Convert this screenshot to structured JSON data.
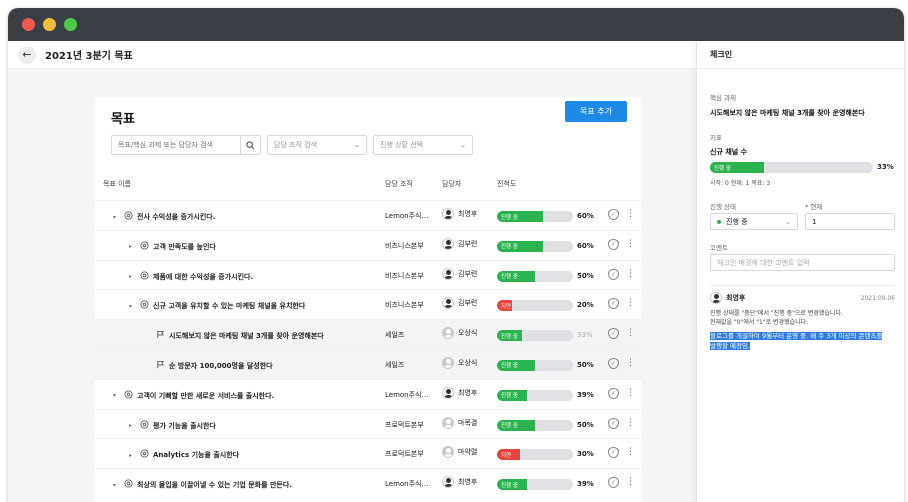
{
  "window": {
    "colors": {
      "close": "#ee5b51",
      "minimize": "#f3bd39",
      "maximize": "#4dc946",
      "titlebar": "#3b3f45"
    }
  },
  "header": {
    "back_icon": "arrow-left-icon",
    "title": "2021년 3분기 목표"
  },
  "goals": {
    "title": "목표",
    "add_button": "목표 추가",
    "search_placeholder": "목표/핵심 과제 또는 담당자 검색",
    "org_filter": "담당 조직 검색",
    "status_filter": "진행 상황 선택",
    "columns": {
      "name": "목표 이름",
      "org": "담당 조직",
      "owner": "담당자",
      "progress": "진척도"
    },
    "rows": [
      {
        "level": 0,
        "caret": "▾",
        "icon": "target",
        "name": "전사 수익성을 증가시킨다.",
        "org": "Lemon주식…",
        "owner": "최영후",
        "avatar": "photo",
        "status": "진행 중",
        "status_color": "#2bb34f",
        "progress": 0.6,
        "pct": "60%"
      },
      {
        "level": 1,
        "caret": "▸",
        "icon": "target",
        "name": "고객 만족도를 높인다",
        "org": "비즈니스본부",
        "owner": "김부련",
        "avatar": "photo",
        "status": "진행 중",
        "status_color": "#2bb34f",
        "progress": 0.6,
        "pct": "60%"
      },
      {
        "level": 1,
        "caret": "▸",
        "icon": "target",
        "name": "제품에 대한 수익성을 증가시킨다.",
        "org": "비즈니스본부",
        "owner": "김부련",
        "avatar": "photo",
        "status": "진행 중",
        "status_color": "#2bb34f",
        "progress": 0.5,
        "pct": "50%"
      },
      {
        "level": 1,
        "caret": "▾",
        "icon": "target",
        "name": "신규 고객을 유치할 수 있는 마케팅 채널을 유치한다",
        "org": "비즈니스본부",
        "owner": "김부련",
        "avatar": "photo",
        "status": "지연",
        "status_color": "#e8433c",
        "progress": 0.2,
        "pct": "20%"
      },
      {
        "level": 2,
        "caret": "",
        "icon": "flag",
        "name": "시도해보지 않은 마케팅 채널 3개를 찾아 운영해본다",
        "org": "세일즈",
        "owner": "오상식",
        "avatar": "initials",
        "status": "진행 중",
        "status_color": "#2bb34f",
        "progress": 0.33,
        "pct": "33%",
        "highlight": true,
        "muted": true
      },
      {
        "level": 2,
        "caret": "",
        "icon": "flag",
        "name": "순 방문자 100,000명을 달성한다",
        "org": "세일즈",
        "owner": "오상식",
        "avatar": "initials",
        "status": "진행 중",
        "status_color": "#2bb34f",
        "progress": 0.5,
        "pct": "50%",
        "highlight": true
      },
      {
        "level": 0,
        "caret": "▾",
        "icon": "target",
        "name": "고객이 기뻐할 만한 새로운 서비스를 출시한다.",
        "org": "Lemon주식…",
        "owner": "최영후",
        "avatar": "photo",
        "status": "진행 중",
        "status_color": "#2bb34f",
        "progress": 0.39,
        "pct": "39%"
      },
      {
        "level": 1,
        "caret": "▸",
        "icon": "target",
        "name": "평가 기능을 출시한다",
        "org": "프로덕트본부",
        "owner": "마목결",
        "avatar": "initials",
        "status": "진행 중",
        "status_color": "#2bb34f",
        "progress": 0.5,
        "pct": "50%"
      },
      {
        "level": 1,
        "caret": "▸",
        "icon": "target",
        "name": "Analytics 기능을 출시한다",
        "org": "프로덕트본부",
        "owner": "마약렬",
        "avatar": "initials",
        "status": "지연",
        "status_color": "#e8433c",
        "progress": 0.3,
        "pct": "30%"
      },
      {
        "level": 0,
        "caret": "▾",
        "icon": "target",
        "name": "최상의 몰입을 이끌어낼 수 있는 기업 문화를 만든다.",
        "org": "Lemon주식…",
        "owner": "최영후",
        "avatar": "photo",
        "status": "진행 중",
        "status_color": "#2bb34f",
        "progress": 0.39,
        "pct": "39%"
      }
    ]
  },
  "checkin": {
    "title": "체크인",
    "task_label": "핵심 과제",
    "task": "시도해보지 않은 마케팅 채널 3개를 찾아 운영해본다",
    "metric_label": "지표",
    "metric_name": "신규 채널 수",
    "metric_status": "진행 중",
    "metric_progress": 0.33,
    "metric_pct": "33%",
    "metric_detail": "시작: 0   현재: 1   목표: 3",
    "status_label": "진행 상태",
    "status_value": "진행 중",
    "current_label": "* 현재",
    "current_value": "1",
    "comment_label": "코멘트",
    "comment_placeholder": "체크인 배경에 대한 코멘트 입력",
    "comment": {
      "author": "최영후",
      "date": "2021.09.06",
      "line1": "진행 상태를 \"중단\"에서 \"진행 중\"으로 변경했습니다.",
      "line2": "현재값을 \"0\"에서 \"1\"로 변경했습니다.",
      "highlight1": "블로그를 개설하여 9월부터 운영 중. 매 주 3개 이상의 콘텐츠를",
      "highlight2": "발행할 예정임."
    }
  }
}
